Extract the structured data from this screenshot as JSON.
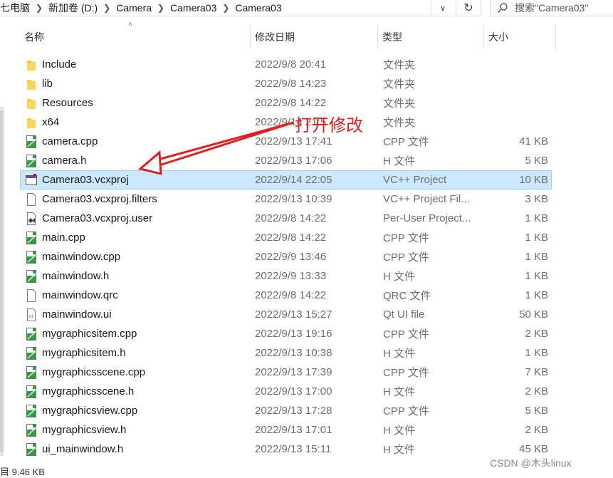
{
  "address": {
    "crumbs": [
      "七电脑",
      "新加卷 (D:)",
      "Camera",
      "Camera03",
      "Camera03"
    ]
  },
  "search": {
    "placeholder": "搜索\"Camera03\""
  },
  "columns": {
    "name": "名称",
    "date": "修改日期",
    "type": "类型",
    "size": "大小"
  },
  "files": [
    {
      "name": "Include",
      "date": "2022/9/8 20:41",
      "type": "文件夹",
      "size": "",
      "icon": "folder-icon"
    },
    {
      "name": "lib",
      "date": "2022/9/8 14:23",
      "type": "文件夹",
      "size": "",
      "icon": "folder-icon"
    },
    {
      "name": "Resources",
      "date": "2022/9/8 14:22",
      "type": "文件夹",
      "size": "",
      "icon": "folder-icon"
    },
    {
      "name": "x64",
      "date": "2022/9/14 21:5",
      "type": "文件夹",
      "size": "",
      "icon": "folder-icon"
    },
    {
      "name": "camera.cpp",
      "date": "2022/9/13 17:41",
      "type": "CPP 文件",
      "size": "41 KB",
      "icon": "cpp-file-icon"
    },
    {
      "name": "camera.h",
      "date": "2022/9/13 17:06",
      "type": "H 文件",
      "size": "5 KB",
      "icon": "h-file-icon"
    },
    {
      "name": "Camera03.vcxproj",
      "date": "2022/9/14 22:05",
      "type": "VC++ Project",
      "size": "10 KB",
      "icon": "vcxproj-file-icon",
      "selected": true
    },
    {
      "name": "Camera03.vcxproj.filters",
      "date": "2022/9/13 10:39",
      "type": "VC++ Project Fil...",
      "size": "3 KB",
      "icon": "blank-file-icon"
    },
    {
      "name": "Camera03.vcxproj.user",
      "date": "2022/9/8 14:22",
      "type": "Per-User Project...",
      "size": "1 KB",
      "icon": "vs-user-file-icon"
    },
    {
      "name": "main.cpp",
      "date": "2022/9/8 14:22",
      "type": "CPP 文件",
      "size": "1 KB",
      "icon": "cpp-file-icon"
    },
    {
      "name": "mainwindow.cpp",
      "date": "2022/9/9 13:46",
      "type": "CPP 文件",
      "size": "1 KB",
      "icon": "cpp-file-icon"
    },
    {
      "name": "mainwindow.h",
      "date": "2022/9/9 13:33",
      "type": "H 文件",
      "size": "1 KB",
      "icon": "h-file-icon"
    },
    {
      "name": "mainwindow.qrc",
      "date": "2022/9/8 14:22",
      "type": "QRC 文件",
      "size": "1 KB",
      "icon": "blank-file-icon"
    },
    {
      "name": "mainwindow.ui",
      "date": "2022/9/13 15:27",
      "type": "Qt UI file",
      "size": "50 KB",
      "icon": "ui-file-icon"
    },
    {
      "name": "mygraphicsitem.cpp",
      "date": "2022/9/13 19:16",
      "type": "CPP 文件",
      "size": "2 KB",
      "icon": "cpp-file-icon"
    },
    {
      "name": "mygraphicsitem.h",
      "date": "2022/9/13 10:38",
      "type": "H 文件",
      "size": "1 KB",
      "icon": "h-file-icon"
    },
    {
      "name": "mygraphicsscene.cpp",
      "date": "2022/9/13 17:39",
      "type": "CPP 文件",
      "size": "7 KB",
      "icon": "cpp-file-icon"
    },
    {
      "name": "mygraphicsscene.h",
      "date": "2022/9/13 17:00",
      "type": "H 文件",
      "size": "2 KB",
      "icon": "h-file-icon"
    },
    {
      "name": "mygraphicsview.cpp",
      "date": "2022/9/13 17:28",
      "type": "CPP 文件",
      "size": "5 KB",
      "icon": "cpp-file-icon"
    },
    {
      "name": "mygraphicsview.h",
      "date": "2022/9/13 17:01",
      "type": "H 文件",
      "size": "2 KB",
      "icon": "h-file-icon"
    },
    {
      "name": "ui_mainwindow.h",
      "date": "2022/9/13 15:11",
      "type": "H 文件",
      "size": "45 KB",
      "icon": "h-file-icon"
    }
  ],
  "annotation": {
    "text": "打开修改",
    "color": "#e02020"
  },
  "status": {
    "text": "目 9.46 KB"
  },
  "watermark": "CSDN @木头linux",
  "colors": {
    "selection": "#cce8ff",
    "selection_border": "#99d1ff",
    "folder": "#f8c93a",
    "cpp_icon": "#2e9e3e"
  }
}
